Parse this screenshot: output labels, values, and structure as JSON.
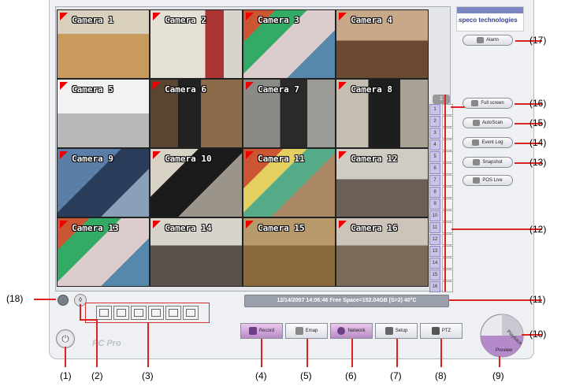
{
  "logo": {
    "text": "speco technologies"
  },
  "cameras": [
    "Camera 1",
    "Camera 2",
    "Camera 3",
    "Camera 4",
    "Camera 5",
    "Camera 6",
    "Camera 7",
    "Camera 8",
    "Camera 9",
    "Camera 10",
    "Camera 11",
    "Camera 12",
    "Camera 13",
    "Camera 14",
    "Camera 15",
    "Camera 16"
  ],
  "status_bar": "12/14/2007 14:06:46  Free Space=152.04GB (S=2) 40°C",
  "channel_icon": "1",
  "channels": [
    "1",
    "2",
    "3",
    "4",
    "5",
    "6",
    "7",
    "8",
    "9",
    "10",
    "11",
    "12",
    "13",
    "14",
    "15",
    "16"
  ],
  "right_buttons": {
    "alarm": "Alarm",
    "full_screen": "Full screen",
    "autoscan": "AutoScan",
    "event_log": "Event Log",
    "snapshot": "Snapshot",
    "pos_live": "POS Live"
  },
  "bottom_buttons": {
    "record": "Record",
    "emap": "Emap",
    "network": "Network",
    "setup": "Setup",
    "ptz": "PTZ",
    "playback": "Playback",
    "preview": "Preview"
  },
  "product": "PC Pro",
  "callouts": {
    "c1": "(1)",
    "c2": "(2)",
    "c3": "(3)",
    "c4": "(4)",
    "c5": "(5)",
    "c6": "(6)",
    "c7": "(7)",
    "c8": "(8)",
    "c9": "(9)",
    "c10": "(10)",
    "c11": "(11)",
    "c12": "(12)",
    "c13": "(13)",
    "c14": "(14)",
    "c15": "(15)",
    "c16": "(16)",
    "c17": "(17)",
    "c18": "(18)"
  },
  "colors": {
    "accent": "#d22222",
    "selected_button": "#b98ac4",
    "shell": "#eef0f4"
  }
}
